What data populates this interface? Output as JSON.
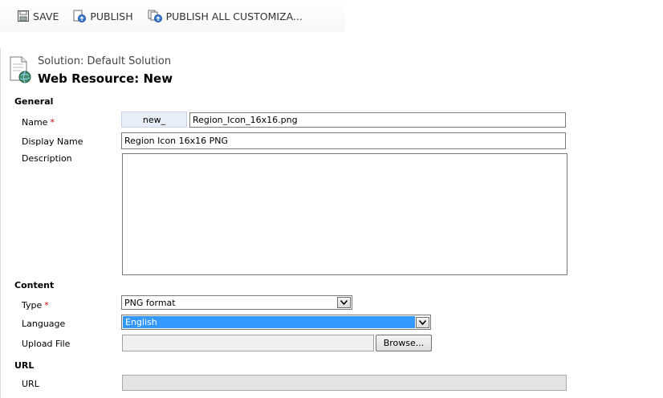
{
  "toolbar": {
    "save_label": "SAVE",
    "publish_label": "PUBLISH",
    "publish_all_label": "PUBLISH ALL CUSTOMIZA..."
  },
  "header": {
    "solution": "Solution: Default Solution",
    "title": "Web Resource: New"
  },
  "general": {
    "section_label": "General",
    "name_label": "Name",
    "name_required": "*",
    "name_prefix": "new_",
    "name_value": "Region_Icon_16x16.png",
    "display_name_label": "Display Name",
    "display_name_value": "Region Icon 16x16 PNG",
    "description_label": "Description",
    "description_value": ""
  },
  "content": {
    "section_label": "Content",
    "type_label": "Type",
    "type_required": "*",
    "type_value": "PNG format",
    "language_label": "Language",
    "language_value": "English",
    "upload_label": "Upload File",
    "browse_label": "Browse..."
  },
  "url": {
    "section_label": "URL",
    "url_label": "URL"
  },
  "colors": {
    "selection": "#3399ff",
    "required": "#d40000",
    "prefix_bg": "#e8eef7"
  }
}
